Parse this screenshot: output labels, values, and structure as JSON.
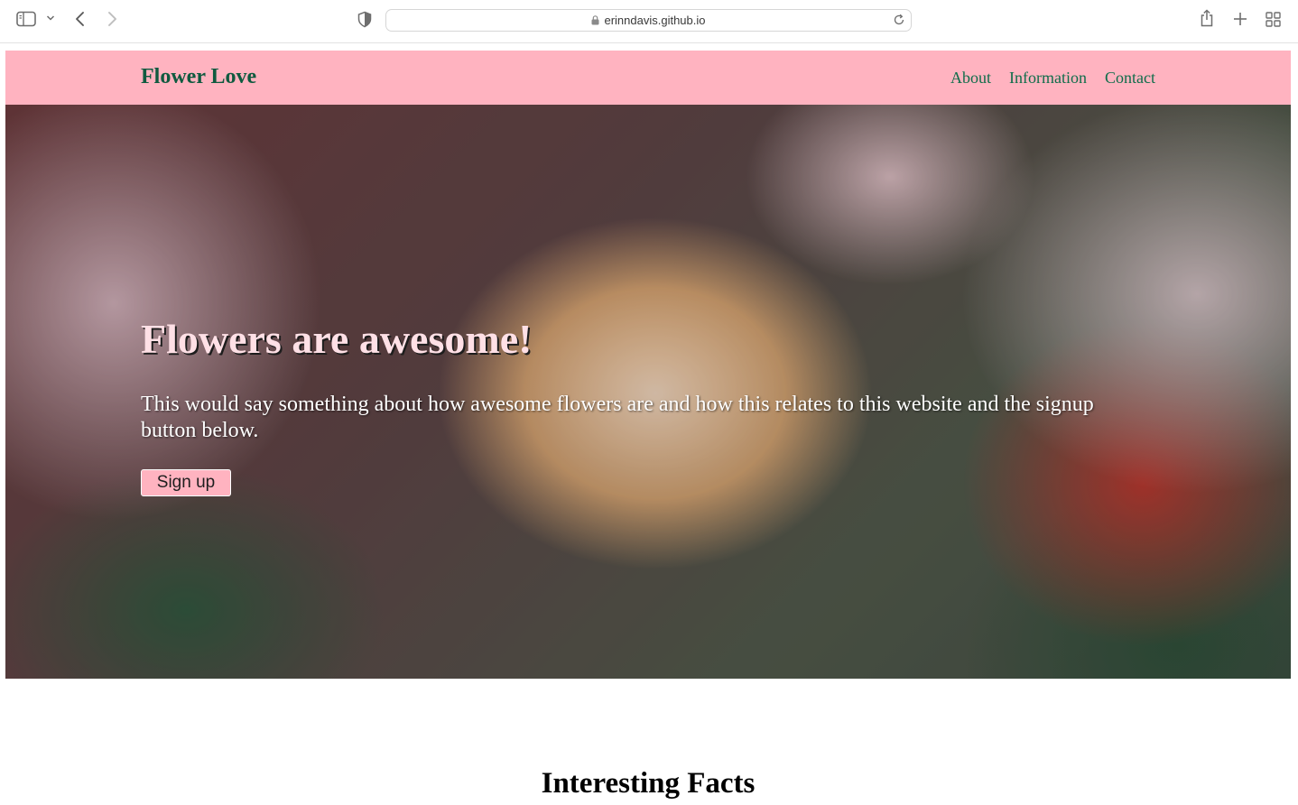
{
  "browser": {
    "url": "erinndavis.github.io",
    "icons": [
      "sidebar-icon",
      "chevron-down-icon",
      "back-arrow-icon",
      "forward-arrow-icon",
      "shield-icon",
      "lock-icon",
      "reload-icon",
      "share-icon",
      "plus-icon",
      "tabs-grid-icon"
    ]
  },
  "site": {
    "brand": "Flower Love",
    "nav": [
      {
        "label": "About"
      },
      {
        "label": "Information"
      },
      {
        "label": "Contact"
      }
    ],
    "colors": {
      "navbar_bg": "#ffb3c0",
      "nav_link": "#0f6d4a",
      "brand": "#0f5a3f",
      "button_bg": "#ffb3c0"
    }
  },
  "hero": {
    "title": "Flowers are awesome!",
    "text": "This would say something about how awesome flowers are and how this relates to this website and the signup button below.",
    "button_label": "Sign up",
    "background": "photo of an orange and white rose"
  },
  "facts": {
    "title": "Interesting Facts"
  }
}
